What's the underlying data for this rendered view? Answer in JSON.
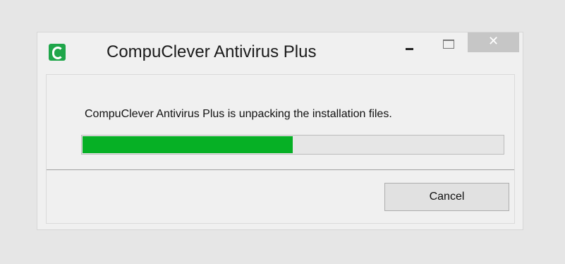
{
  "window": {
    "title": "CompuClever Antivirus Plus",
    "app_icon": "compuclever-logo-icon",
    "controls": {
      "minimize_icon": "minimize-icon",
      "maximize_icon": "maximize-icon",
      "close_icon": "close-icon",
      "close_glyph": "✕"
    }
  },
  "dialog": {
    "message": "CompuClever Antivirus Plus is unpacking the installation files.",
    "progress": 0.5,
    "cancel_label": "Cancel"
  },
  "colors": {
    "progress_fill": "#06b025",
    "app_icon": "#1fa64a",
    "close_button": "#c6c6c6"
  }
}
